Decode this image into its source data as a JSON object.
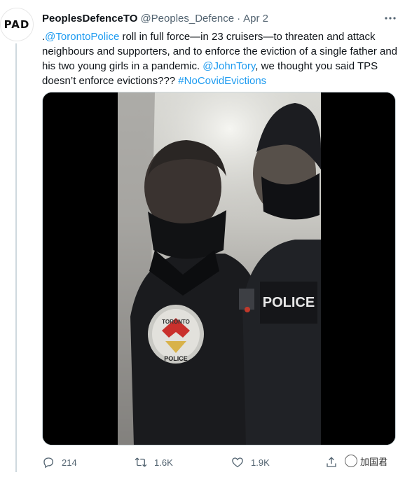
{
  "author": {
    "display_name": "PeoplesDefenceTO",
    "handle": "@Peoples_Defence",
    "separator": "·",
    "date": "Apr 2",
    "avatar_text": "PAD"
  },
  "tweet": {
    "prefix": ".",
    "mention_police": "@TorontoPolice",
    "text_1": " roll in full force—in 23 cruisers—to threaten and attack neighbours and supporters, and to enforce the eviction of a single father and his two young girls in a pandemic. ",
    "mention_mayor": "@JohnTory",
    "text_2": ", we thought you said TPS doesn’t enforce evictions??? ",
    "hashtag": "#NoCovidEvictions"
  },
  "media": {
    "badge_top": "TORONTO",
    "badge_bottom": "POLICE",
    "vest_text": "POLICE"
  },
  "actions": {
    "reply_count": "214",
    "retweet_count": "1.6K",
    "like_count": "1.9K"
  },
  "watermark": {
    "text": "加国君"
  },
  "colors": {
    "link": "#1d9bf0",
    "secondary_text": "#536471",
    "primary_text": "#0f1419"
  }
}
